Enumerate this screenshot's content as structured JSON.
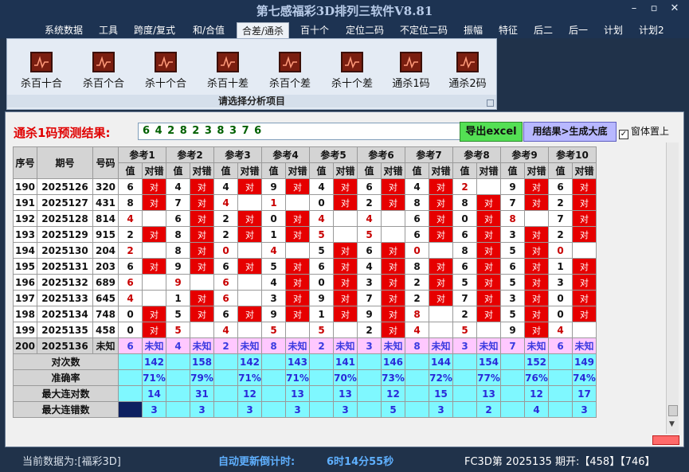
{
  "window": {
    "title": "第七感福彩3D排列三软件V8.81"
  },
  "menu": {
    "items": [
      "系统数据",
      "工具",
      "跨度/复式",
      "和/合值",
      "合差/通杀",
      "百十个",
      "定位二码",
      "不定位二码",
      "振幅",
      "特征",
      "后二",
      "后一",
      "计划",
      "计划2"
    ],
    "active_index": 4
  },
  "ribbon": {
    "buttons": [
      "杀百十合",
      "杀百个合",
      "杀十个合",
      "杀百十差",
      "杀百个差",
      "杀十个差",
      "通杀1码",
      "通杀2码"
    ],
    "caption": "请选择分析项目"
  },
  "prediction": {
    "label": "通杀1码预测结果:",
    "value": "6 4 2 8 2 3 8 3 7 6",
    "export_button": "导出excel",
    "generate_button": "用结果>生成大底",
    "checkbox_label": "窗体置上",
    "checkbox_checked": true
  },
  "table": {
    "headers": {
      "seq": "序号",
      "period": "期号",
      "number": "号码",
      "sub_value": "值",
      "sub_result": "对错"
    },
    "ref_labels": [
      "参考1",
      "参考2",
      "参考3",
      "参考4",
      "参考5",
      "参考6",
      "参考7",
      "参考8",
      "参考9",
      "参考10"
    ],
    "hit_text": "对",
    "rows": [
      {
        "seq": "190",
        "period": "2025126",
        "number": "320",
        "vals": [
          "6",
          "4",
          "4",
          "9",
          "4",
          "6",
          "4",
          "2",
          "9",
          "6"
        ],
        "ok": [
          1,
          1,
          1,
          1,
          1,
          1,
          1,
          0,
          1,
          1
        ]
      },
      {
        "seq": "191",
        "period": "2025127",
        "number": "431",
        "vals": [
          "8",
          "7",
          "4",
          "1",
          "0",
          "2",
          "8",
          "8",
          "7",
          "2"
        ],
        "ok": [
          1,
          1,
          0,
          0,
          1,
          1,
          1,
          1,
          1,
          1
        ]
      },
      {
        "seq": "192",
        "period": "2025128",
        "number": "814",
        "vals": [
          "4",
          "6",
          "2",
          "0",
          "4",
          "4",
          "6",
          "0",
          "8",
          "7"
        ],
        "ok": [
          0,
          1,
          1,
          1,
          0,
          0,
          1,
          1,
          0,
          1
        ]
      },
      {
        "seq": "193",
        "period": "2025129",
        "number": "915",
        "vals": [
          "2",
          "8",
          "2",
          "1",
          "5",
          "5",
          "6",
          "6",
          "3",
          "2"
        ],
        "ok": [
          1,
          1,
          1,
          1,
          0,
          0,
          1,
          1,
          1,
          1
        ]
      },
      {
        "seq": "194",
        "period": "2025130",
        "number": "204",
        "vals": [
          "2",
          "8",
          "0",
          "4",
          "5",
          "6",
          "0",
          "8",
          "5",
          "0"
        ],
        "ok": [
          0,
          1,
          0,
          0,
          1,
          1,
          0,
          1,
          1,
          0
        ]
      },
      {
        "seq": "195",
        "period": "2025131",
        "number": "203",
        "vals": [
          "6",
          "9",
          "6",
          "5",
          "6",
          "4",
          "8",
          "6",
          "6",
          "1"
        ],
        "ok": [
          1,
          1,
          1,
          1,
          1,
          1,
          1,
          1,
          1,
          1
        ]
      },
      {
        "seq": "196",
        "period": "2025132",
        "number": "689",
        "vals": [
          "6",
          "9",
          "6",
          "4",
          "0",
          "3",
          "2",
          "5",
          "5",
          "3"
        ],
        "ok": [
          0,
          0,
          0,
          1,
          1,
          1,
          1,
          1,
          1,
          1
        ]
      },
      {
        "seq": "197",
        "period": "2025133",
        "number": "645",
        "vals": [
          "4",
          "1",
          "6",
          "3",
          "9",
          "7",
          "2",
          "7",
          "3",
          "0"
        ],
        "ok": [
          0,
          1,
          0,
          1,
          1,
          1,
          1,
          1,
          1,
          1
        ]
      },
      {
        "seq": "198",
        "period": "2025134",
        "number": "748",
        "vals": [
          "0",
          "5",
          "6",
          "9",
          "1",
          "9",
          "8",
          "2",
          "5",
          "0"
        ],
        "ok": [
          1,
          1,
          1,
          1,
          1,
          1,
          0,
          1,
          1,
          1
        ]
      },
      {
        "seq": "199",
        "period": "2025135",
        "number": "458",
        "vals": [
          "0",
          "5",
          "4",
          "5",
          "5",
          "2",
          "4",
          "5",
          "9",
          "4"
        ],
        "ok": [
          1,
          0,
          0,
          0,
          0,
          1,
          0,
          0,
          1,
          0
        ]
      }
    ],
    "current": {
      "seq": "200",
      "period": "2025136",
      "number": "未知",
      "vals": [
        "6",
        "4",
        "2",
        "8",
        "2",
        "3",
        "8",
        "3",
        "7",
        "6"
      ],
      "result": "未知"
    },
    "stats": [
      {
        "label": "对次数",
        "values": [
          "142",
          "158",
          "142",
          "143",
          "141",
          "146",
          "144",
          "154",
          "152",
          "149"
        ]
      },
      {
        "label": "准确率",
        "values": [
          "71%",
          "79%",
          "71%",
          "71%",
          "70%",
          "73%",
          "72%",
          "77%",
          "76%",
          "74%"
        ]
      },
      {
        "label": "最大连对数",
        "values": [
          "14",
          "31",
          "12",
          "13",
          "13",
          "12",
          "15",
          "13",
          "12",
          "17"
        ]
      },
      {
        "label": "最大连错数",
        "values": [
          "3",
          "3",
          "3",
          "3",
          "3",
          "5",
          "3",
          "2",
          "4",
          "3"
        ]
      }
    ]
  },
  "status": {
    "data_label": "当前数据为:[福彩3D]",
    "countdown_label": "自动更新倒计时:",
    "countdown_value": "6时14分55秒",
    "period_info": "FC3D第 2025135 期开:【458】【746】"
  },
  "icons": [
    "chart-icon",
    "minimize-icon",
    "maximize-icon",
    "close-icon",
    "checkbox-check-icon",
    "scroll-down-icon"
  ],
  "colors": {
    "hit": "#e60000",
    "current_row": "#ffc8ff",
    "stats": "#7ff8ff",
    "title": "#b8cbe8",
    "prediction_label": "#e00000",
    "prediction_value": "#006000",
    "excel_button": "#54e054",
    "generate_button": "#b8b8ff"
  }
}
